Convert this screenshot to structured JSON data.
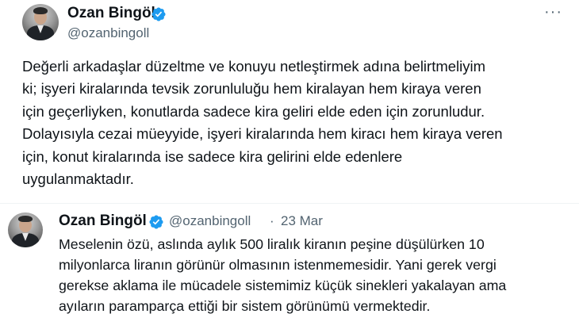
{
  "main_tweet": {
    "author_name": "Ozan Bingöl",
    "author_handle": "@ozanbingoll",
    "more_label": "···",
    "lines": [
      "Değerli arkadaşlar düzeltme ve konuyu netleştirmek adına belirtmeliyim",
      "ki; işyeri kiralarında tevsik zorunluluğu hem kiralayan hem kiraya veren",
      "için geçerliyken, konutlarda sadece kira geliri elde eden için zorunludur.",
      "Dolayısıyla cezai müeyyide, işyeri kiralarında hem kiracı hem kiraya veren",
      "için, konut kiralarında ise sadece kira gelirini elde edenlere",
      "uygulanmaktadır."
    ]
  },
  "quoted_tweet": {
    "author_name": "Ozan Bingöl",
    "author_handle": "@ozanbingoll",
    "separator": "·",
    "date": "23 Mar",
    "lines": [
      "Meselenin özü, aslında aylık 500 liralık kiranın peşine düşülürken 10",
      "milyonlarca liranın görünür olmasının istenmemesidir. Yani gerek vergi",
      "gerekse aklama ile mücadele sistemimiz küçük sinekleri yakalayan ama",
      "ayıların paramparça ettiği bir sistem görünümü vermektedir."
    ]
  },
  "colors": {
    "verified_badge": "#1d9bf0",
    "secondary_text": "#536471",
    "primary_text": "#0f1419"
  }
}
